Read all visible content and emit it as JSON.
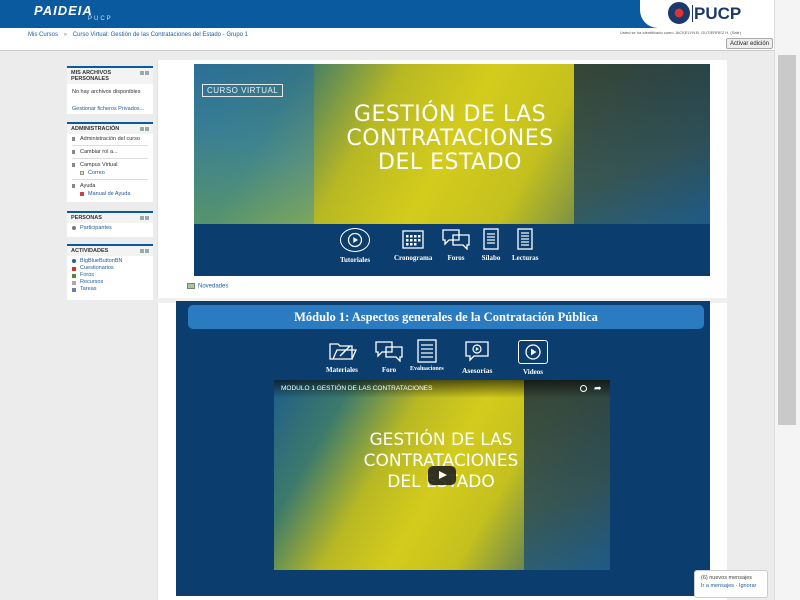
{
  "header": {
    "logo": "PAIDEIA",
    "logo_sub": "PUCP",
    "university": "PUCP"
  },
  "breadcrumb": {
    "items": [
      "Mis Cursos",
      "Curso Virtual: Gestión de las Contrataciones del Estado - Grupo 1"
    ]
  },
  "user": {
    "logged_in_text": "Usted se ha identificado como JACKELYN B. GUTIERREZ H. (Salir)"
  },
  "toolbar": {
    "edit_label": "Activar edición"
  },
  "sidebar": {
    "private_files": {
      "title": "MIS ARCHIVOS PERSONALES",
      "empty": "No hay archivos disponibles",
      "manage": "Gestionar ficheros Privados..."
    },
    "admin": {
      "title": "ADMINISTRACIÓN",
      "items": [
        "Administración del curso",
        "Cambiar rol a...",
        "Campus Virtual",
        "Correo",
        "Ayuda",
        "Manual de Ayuda"
      ]
    },
    "people": {
      "title": "PERSONAS",
      "items": [
        "Participantes"
      ]
    },
    "activities": {
      "title": "ACTIVIDADES",
      "items": [
        "BigBlueButtonBN",
        "Cuestionarios",
        "Foros",
        "Recursos",
        "Tareas"
      ]
    }
  },
  "banner": {
    "tag": "CURSO VIRTUAL",
    "title_lines": [
      "GESTIÓN DE LAS",
      "CONTRATACIONES",
      "DEL ESTADO"
    ],
    "icons": [
      {
        "label": "Tutoriales",
        "icon": "play-icon"
      },
      {
        "label": "Cronograma",
        "icon": "calendar-icon"
      },
      {
        "label": "Foros",
        "icon": "chat-icon"
      },
      {
        "label": "Sílabo",
        "icon": "document-icon"
      },
      {
        "label": "Lecturas",
        "icon": "book-icon"
      }
    ]
  },
  "news": {
    "label": "Novedades"
  },
  "module": {
    "title": "Módulo 1: Aspectos generales de la Contratación Pública",
    "icons": [
      {
        "label": "Materiales",
        "icon": "folder-icon"
      },
      {
        "label": "Foro",
        "icon": "chat-icon"
      },
      {
        "label": "Evaluaciones",
        "icon": "checklist-icon"
      },
      {
        "label": "Asesorías",
        "icon": "video-chat-icon"
      },
      {
        "label": "Videos",
        "icon": "play-icon"
      }
    ]
  },
  "video": {
    "title": "MODULO 1 GESTIÓN DE LAS CONTRATACIONES",
    "big_lines": [
      "GESTIÓN DE LAS",
      "CONTRATACIONES",
      "DEL ESTADO"
    ]
  },
  "messages": {
    "count_text": "(6) nuevos mensajes",
    "go_link": "Ir a mensajes",
    "ignore_link": "Ignorar"
  }
}
